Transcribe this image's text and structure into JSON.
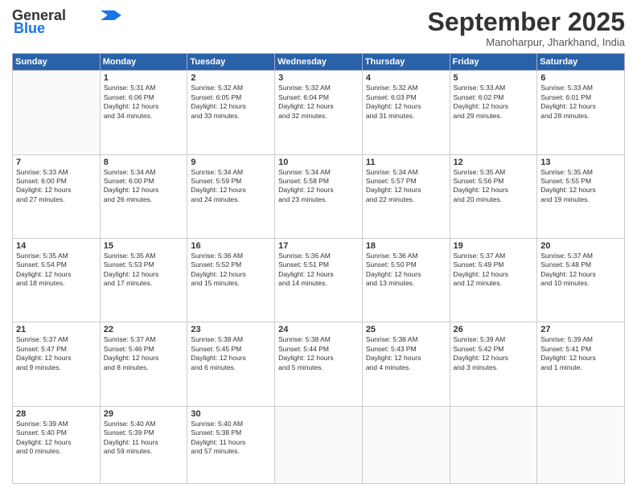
{
  "header": {
    "logo_line1": "General",
    "logo_line2": "Blue",
    "month": "September 2025",
    "location": "Manoharpur, Jharkhand, India"
  },
  "days_of_week": [
    "Sunday",
    "Monday",
    "Tuesday",
    "Wednesday",
    "Thursday",
    "Friday",
    "Saturday"
  ],
  "weeks": [
    [
      {
        "day": "",
        "text": ""
      },
      {
        "day": "1",
        "text": "Sunrise: 5:31 AM\nSunset: 6:06 PM\nDaylight: 12 hours\nand 34 minutes."
      },
      {
        "day": "2",
        "text": "Sunrise: 5:32 AM\nSunset: 6:05 PM\nDaylight: 12 hours\nand 33 minutes."
      },
      {
        "day": "3",
        "text": "Sunrise: 5:32 AM\nSunset: 6:04 PM\nDaylight: 12 hours\nand 32 minutes."
      },
      {
        "day": "4",
        "text": "Sunrise: 5:32 AM\nSunset: 6:03 PM\nDaylight: 12 hours\nand 31 minutes."
      },
      {
        "day": "5",
        "text": "Sunrise: 5:33 AM\nSunset: 6:02 PM\nDaylight: 12 hours\nand 29 minutes."
      },
      {
        "day": "6",
        "text": "Sunrise: 5:33 AM\nSunset: 6:01 PM\nDaylight: 12 hours\nand 28 minutes."
      }
    ],
    [
      {
        "day": "7",
        "text": "Sunrise: 5:33 AM\nSunset: 6:00 PM\nDaylight: 12 hours\nand 27 minutes."
      },
      {
        "day": "8",
        "text": "Sunrise: 5:34 AM\nSunset: 6:00 PM\nDaylight: 12 hours\nand 26 minutes."
      },
      {
        "day": "9",
        "text": "Sunrise: 5:34 AM\nSunset: 5:59 PM\nDaylight: 12 hours\nand 24 minutes."
      },
      {
        "day": "10",
        "text": "Sunrise: 5:34 AM\nSunset: 5:58 PM\nDaylight: 12 hours\nand 23 minutes."
      },
      {
        "day": "11",
        "text": "Sunrise: 5:34 AM\nSunset: 5:57 PM\nDaylight: 12 hours\nand 22 minutes."
      },
      {
        "day": "12",
        "text": "Sunrise: 5:35 AM\nSunset: 5:56 PM\nDaylight: 12 hours\nand 20 minutes."
      },
      {
        "day": "13",
        "text": "Sunrise: 5:35 AM\nSunset: 5:55 PM\nDaylight: 12 hours\nand 19 minutes."
      }
    ],
    [
      {
        "day": "14",
        "text": "Sunrise: 5:35 AM\nSunset: 5:54 PM\nDaylight: 12 hours\nand 18 minutes."
      },
      {
        "day": "15",
        "text": "Sunrise: 5:35 AM\nSunset: 5:53 PM\nDaylight: 12 hours\nand 17 minutes."
      },
      {
        "day": "16",
        "text": "Sunrise: 5:36 AM\nSunset: 5:52 PM\nDaylight: 12 hours\nand 15 minutes."
      },
      {
        "day": "17",
        "text": "Sunrise: 5:36 AM\nSunset: 5:51 PM\nDaylight: 12 hours\nand 14 minutes."
      },
      {
        "day": "18",
        "text": "Sunrise: 5:36 AM\nSunset: 5:50 PM\nDaylight: 12 hours\nand 13 minutes."
      },
      {
        "day": "19",
        "text": "Sunrise: 5:37 AM\nSunset: 5:49 PM\nDaylight: 12 hours\nand 12 minutes."
      },
      {
        "day": "20",
        "text": "Sunrise: 5:37 AM\nSunset: 5:48 PM\nDaylight: 12 hours\nand 10 minutes."
      }
    ],
    [
      {
        "day": "21",
        "text": "Sunrise: 5:37 AM\nSunset: 5:47 PM\nDaylight: 12 hours\nand 9 minutes."
      },
      {
        "day": "22",
        "text": "Sunrise: 5:37 AM\nSunset: 5:46 PM\nDaylight: 12 hours\nand 8 minutes."
      },
      {
        "day": "23",
        "text": "Sunrise: 5:38 AM\nSunset: 5:45 PM\nDaylight: 12 hours\nand 6 minutes."
      },
      {
        "day": "24",
        "text": "Sunrise: 5:38 AM\nSunset: 5:44 PM\nDaylight: 12 hours\nand 5 minutes."
      },
      {
        "day": "25",
        "text": "Sunrise: 5:38 AM\nSunset: 5:43 PM\nDaylight: 12 hours\nand 4 minutes."
      },
      {
        "day": "26",
        "text": "Sunrise: 5:39 AM\nSunset: 5:42 PM\nDaylight: 12 hours\nand 3 minutes."
      },
      {
        "day": "27",
        "text": "Sunrise: 5:39 AM\nSunset: 5:41 PM\nDaylight: 12 hours\nand 1 minute."
      }
    ],
    [
      {
        "day": "28",
        "text": "Sunrise: 5:39 AM\nSunset: 5:40 PM\nDaylight: 12 hours\nand 0 minutes."
      },
      {
        "day": "29",
        "text": "Sunrise: 5:40 AM\nSunset: 5:39 PM\nDaylight: 11 hours\nand 59 minutes."
      },
      {
        "day": "30",
        "text": "Sunrise: 5:40 AM\nSunset: 5:38 PM\nDaylight: 11 hours\nand 57 minutes."
      },
      {
        "day": "",
        "text": ""
      },
      {
        "day": "",
        "text": ""
      },
      {
        "day": "",
        "text": ""
      },
      {
        "day": "",
        "text": ""
      }
    ]
  ]
}
